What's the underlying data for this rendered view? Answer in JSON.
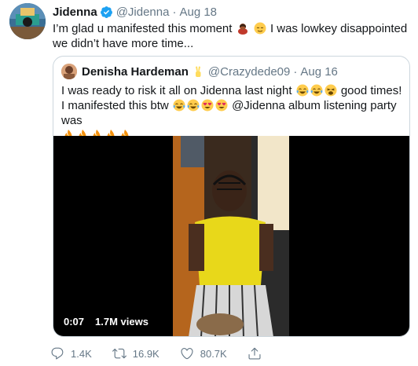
{
  "tweet": {
    "author": {
      "name": "Jidenna",
      "handle": "@Jidenna",
      "verified": true
    },
    "date": "Aug 18",
    "separator": "·",
    "text_before": "I’m glad u manifested this moment",
    "text_after": "I was lowkey disappointed we didn’t have more time...",
    "text_emojis": [
      "woman-bowing-emoji",
      "relieved-face-emoji"
    ]
  },
  "quoted": {
    "author": {
      "name": "Denisha Hardeman",
      "handle": "@Crazydede09"
    },
    "name_emoji": "victory-hand-emoji",
    "date": "Aug 16",
    "separator": "·",
    "text_part1": "I was ready to risk it all on Jidenna last night",
    "text_part2": "good times! I manifested this btw",
    "text_part3": "@Jidenna album listening party was",
    "part1_emojis": [
      "tears-of-joy-emoji",
      "tears-of-joy-emoji",
      "weary-face-emoji"
    ],
    "part2_emojis": [
      "tears-of-joy-emoji",
      "tears-of-joy-emoji",
      "heart-eyes-emoji",
      "heart-eyes-emoji"
    ],
    "part3_emojis": [
      "fire-emoji",
      "fire-emoji",
      "fire-emoji",
      "fire-emoji",
      "fire-emoji"
    ],
    "video": {
      "duration": "0:07",
      "views": "1.7M views"
    }
  },
  "actions": {
    "replies": "1.4K",
    "retweets": "16.9K",
    "likes": "80.7K"
  },
  "colors": {
    "verified": "#1da1f2",
    "secondary_text": "#657786",
    "border": "#ccd6dd"
  }
}
